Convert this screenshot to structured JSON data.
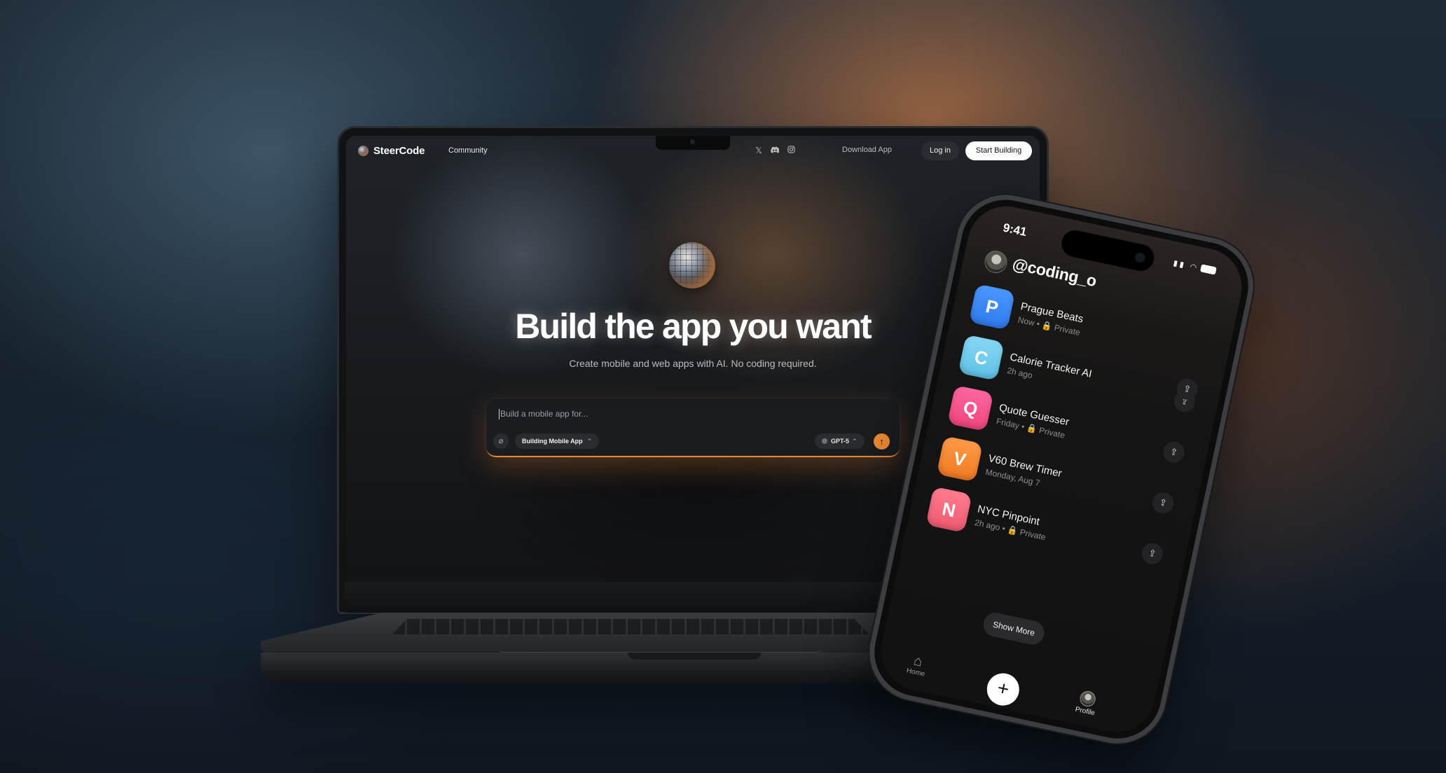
{
  "laptop": {
    "nav": {
      "brand": "SteerCode",
      "community": "Community",
      "social_icons": [
        "x-icon",
        "discord-icon",
        "instagram-icon"
      ],
      "download_label": "Download App",
      "login_label": "Log in",
      "start_label": "Start Building"
    },
    "hero": {
      "title": "Build the app you want",
      "subtitle": "Create mobile and web apps with AI. No coding required."
    },
    "prompt": {
      "placeholder": "Build a mobile app for...",
      "mode_label": "Building Mobile App",
      "model_label": "GPT-5"
    }
  },
  "phone": {
    "time": "9:41",
    "username": "@coding_o",
    "apps": [
      {
        "initial": "P",
        "name": "Prague Beats",
        "meta": "Now • 🔒 Private",
        "color": "#2f7cf0"
      },
      {
        "initial": "C",
        "name": "Calorie Tracker AI",
        "meta": "2h ago",
        "color": "#5fc2e8"
      },
      {
        "initial": "Q",
        "name": "Quote Guesser",
        "meta": "Friday • 🔒 Private",
        "color": "#f0457e"
      },
      {
        "initial": "V",
        "name": "V60 Brew Timer",
        "meta": "Monday, Aug 7",
        "color": "#f07a22"
      },
      {
        "initial": "N",
        "name": "NYC Pinpoint",
        "meta": "2h ago • 🔒 Private",
        "color": "#f05a70"
      }
    ],
    "show_more": "Show More",
    "tabs": {
      "home": "Home",
      "profile": "Profile"
    }
  },
  "colors": {
    "accent": "#ef8a2f",
    "background_warm": "#c47a48",
    "background_cool": "#587a92"
  }
}
